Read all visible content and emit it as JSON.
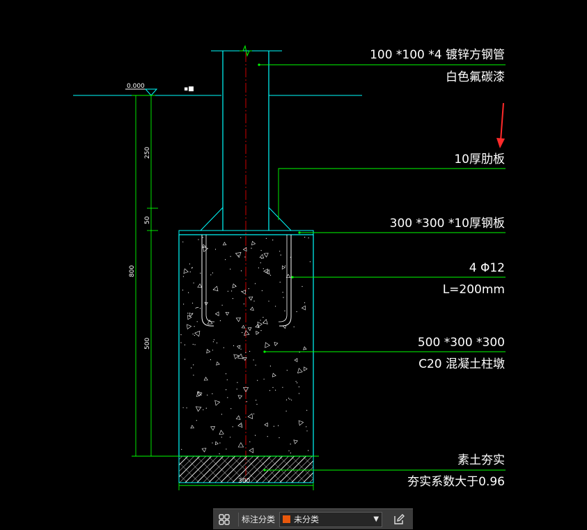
{
  "drawing": {
    "labels": [
      "100 *100 *4 镀锌方钢管",
      "白色氟碳漆",
      "10厚肋板",
      "300 *300 *10厚钢板",
      "4 Φ12",
      "L=200mm",
      "500 *300 *300",
      "C20 混凝土柱墩",
      "素土夯实",
      "夯实系数大于0.96"
    ],
    "elevation": "0.000",
    "dimensions": {
      "total_height": "800",
      "upper_segment": "250",
      "middle_segment": "50",
      "lower_segment": "500",
      "base_width": "300"
    }
  },
  "toolbar": {
    "grid_icon": "grid-icon",
    "label": "标注分类",
    "selected_category": "未分类",
    "category_color": "#e8580c",
    "edit_icon": "edit-icon"
  },
  "colors": {
    "outline": "#00ffff",
    "leader": "#00ff00",
    "hatch": "#ffffff",
    "centerline": "#ff0000",
    "arrow": "#ff2a2a"
  }
}
